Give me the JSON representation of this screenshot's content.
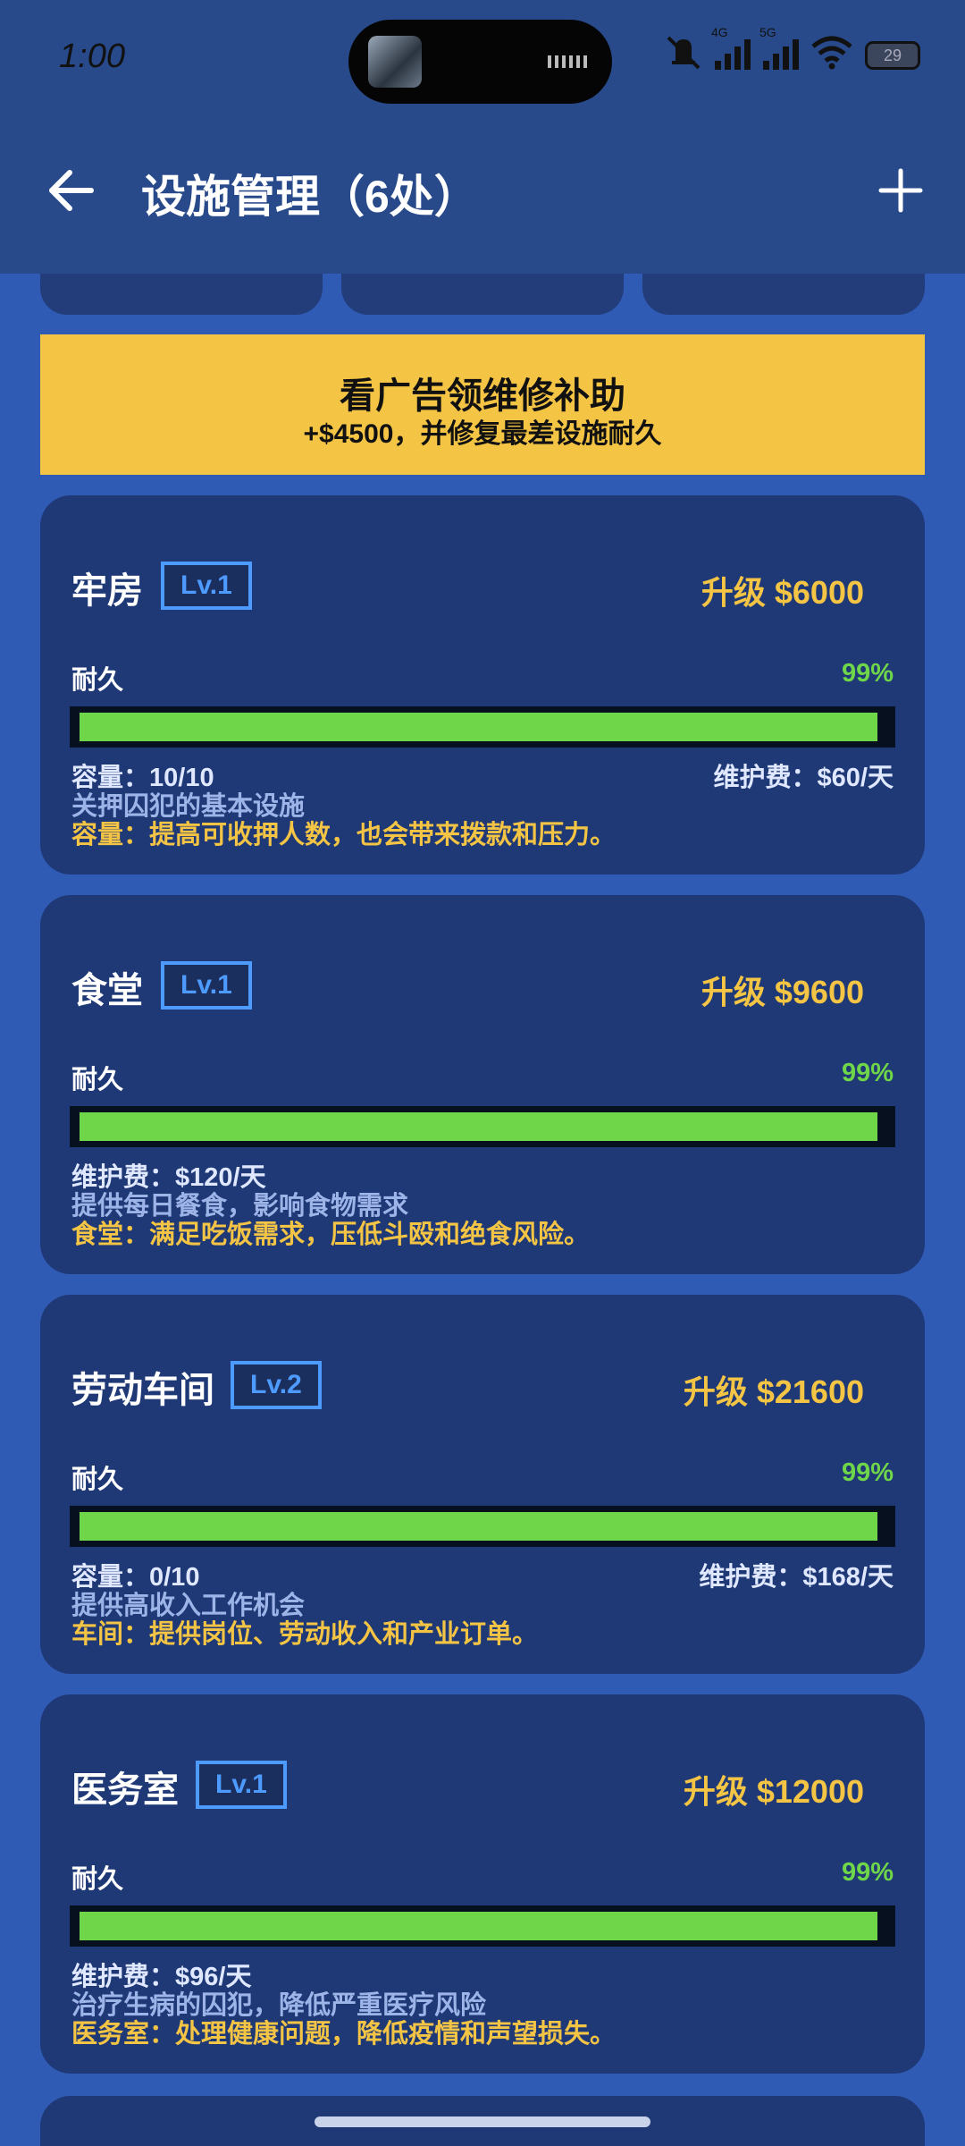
{
  "status_bar": {
    "time": "1:00",
    "battery": "29",
    "net1": "4G",
    "net2": "5G"
  },
  "header": {
    "title": "设施管理（6处）"
  },
  "ad": {
    "title": "看广告领维修补助",
    "subtitle": "+$4500，并修复最差设施耐久"
  },
  "facilities": [
    {
      "name": "牢房",
      "level": "Lv.1",
      "upgrade": "升级  $6000",
      "durability_label": "耐久",
      "durability": "99%",
      "durability_value": 0.99,
      "line1": "容量：10/10",
      "line1_right": "维护费：$60/天",
      "line2": "关押囚犯的基本设施",
      "line3": "容量：提高可收押人数，也会带来拨款和压力。"
    },
    {
      "name": "食堂",
      "level": "Lv.1",
      "upgrade": "升级  $9600",
      "durability_label": "耐久",
      "durability": "99%",
      "durability_value": 0.99,
      "line1": "维护费：$120/天",
      "line1_right": "",
      "line2": "提供每日餐食，影响食物需求",
      "line3": "食堂：满足吃饭需求，压低斗殴和绝食风险。"
    },
    {
      "name": "劳动车间",
      "level": "Lv.2",
      "upgrade": "升级  $21600",
      "durability_label": "耐久",
      "durability": "99%",
      "durability_value": 0.99,
      "line1": "容量：0/10",
      "line1_right": "维护费：$168/天",
      "line2": "提供高收入工作机会",
      "line3": "车间：提供岗位、劳动收入和产业订单。"
    },
    {
      "name": "医务室",
      "level": "Lv.1",
      "upgrade": "升级  $12000",
      "durability_label": "耐久",
      "durability": "99%",
      "durability_value": 0.99,
      "line1": "维护费：$96/天",
      "line1_right": "",
      "line2": "治疗生病的囚犯，降低严重医疗风险",
      "line3": "医务室：处理健康问题，降低疫情和声望损失。"
    }
  ],
  "colors": {
    "background": "#2f5bb5",
    "card": "#1f3876",
    "accent_yellow": "#f4c445",
    "durability_green": "#6fd64a",
    "level_blue": "#4e9bff"
  }
}
